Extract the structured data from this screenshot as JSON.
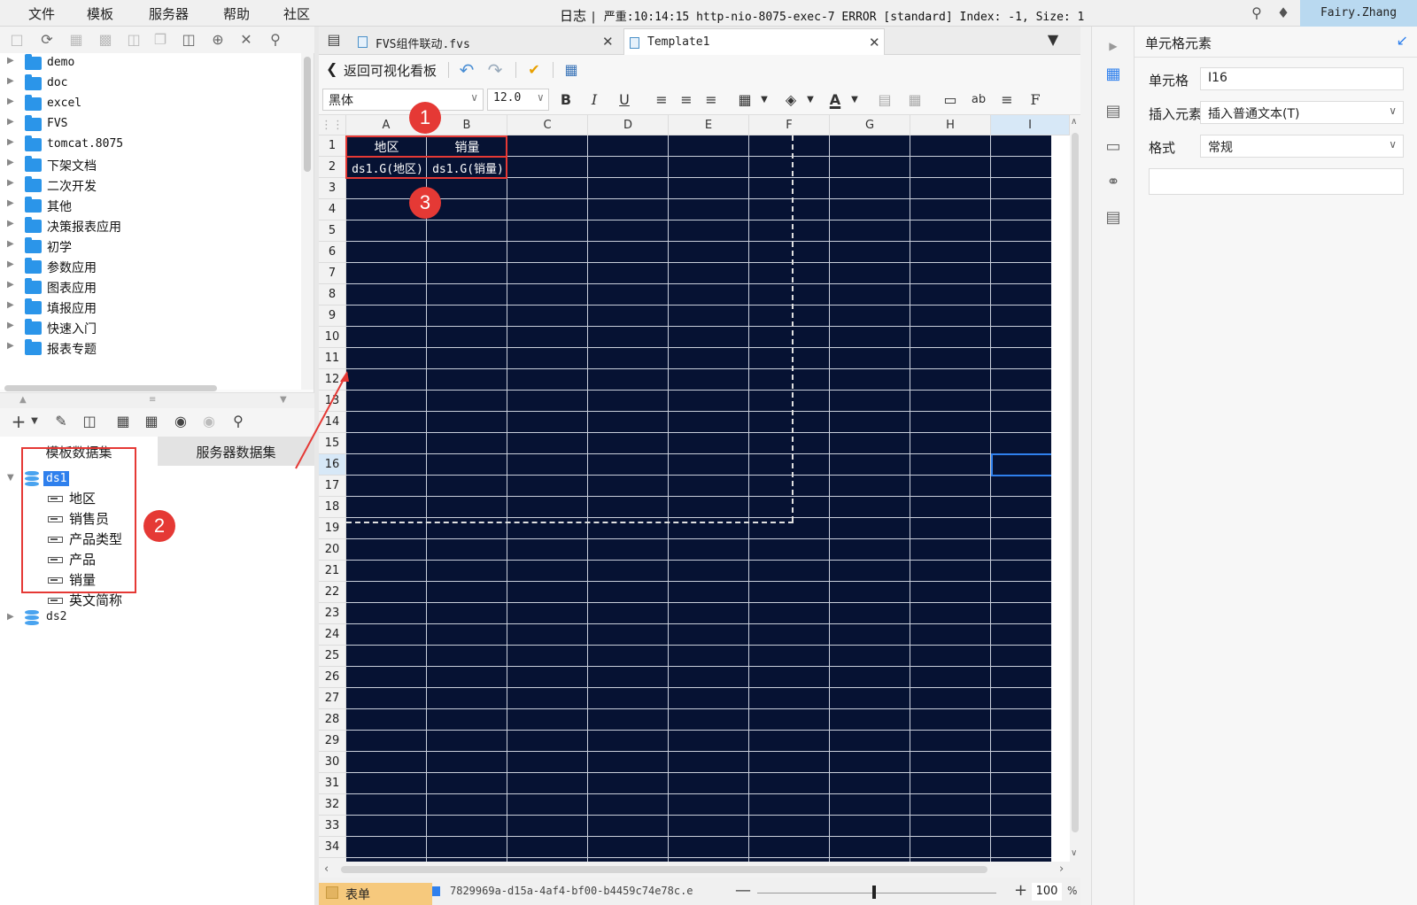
{
  "menubar": {
    "items": [
      "文件",
      "模板",
      "服务器",
      "帮助",
      "社区"
    ],
    "log_label": "日志",
    "log_message": "| 严重:10:14:15 http-nio-8075-exec-7 ERROR [standard] Index: -1, Size: 1",
    "user": "Fairy.Zhang"
  },
  "file_tree": {
    "items": [
      "demo",
      "doc",
      "excel",
      "FVS",
      "tomcat.8075",
      "下架文档",
      "二次开发",
      "其他",
      "决策报表应用",
      "初学",
      "参数应用",
      "图表应用",
      "填报应用",
      "快速入门",
      "报表专题"
    ]
  },
  "dataset_tabs": [
    "模板数据集",
    "服务器数据集"
  ],
  "datasets": {
    "ds1": {
      "name": "ds1",
      "fields": [
        "地区",
        "销售员",
        "产品类型",
        "产品",
        "销量",
        "英文简称"
      ]
    },
    "ds2": {
      "name": "ds2"
    }
  },
  "tabs": [
    {
      "label": "FVS组件联动.fvs",
      "icon": "fvs-file-icon"
    },
    {
      "label": "Template1",
      "icon": "cpt-file-icon"
    }
  ],
  "toolbar": {
    "back_label": "返回可视化看板",
    "font_name": "黑体",
    "font_size": "12.0"
  },
  "grid": {
    "columns": [
      "A",
      "B",
      "C",
      "D",
      "E",
      "F",
      "G",
      "H",
      "I"
    ],
    "rows": [
      "1",
      "2",
      "3",
      "4",
      "5",
      "6",
      "7",
      "8",
      "9",
      "10",
      "11",
      "12",
      "13",
      "14",
      "15",
      "16",
      "17",
      "18",
      "19",
      "20",
      "21",
      "22",
      "23",
      "24",
      "25",
      "26",
      "27",
      "28",
      "29",
      "30",
      "31",
      "32",
      "33",
      "34"
    ],
    "selected_col": "I",
    "selected_row": "16",
    "cells": {
      "A1": "地区",
      "B1": "销量",
      "A2": "ds1.G(地区)",
      "B2": "ds1.G(销量)"
    }
  },
  "annotations": [
    "1",
    "2",
    "3"
  ],
  "status": {
    "sheet_tab": "表单",
    "file_id": "7829969a-d15a-4af4-bf00-b4459c74e78c.e",
    "zoom": "100",
    "zoom_unit": "%"
  },
  "properties": {
    "title": "单元格元素",
    "cell_label": "单元格",
    "cell_value": "I16",
    "insert_label": "插入元素",
    "insert_value": "插入普通文本(T)",
    "format_label": "格式",
    "format_value": "常规"
  },
  "colors": {
    "grid_bg": "#061233",
    "accent": "#2f80ed",
    "annotation": "#e53935"
  }
}
